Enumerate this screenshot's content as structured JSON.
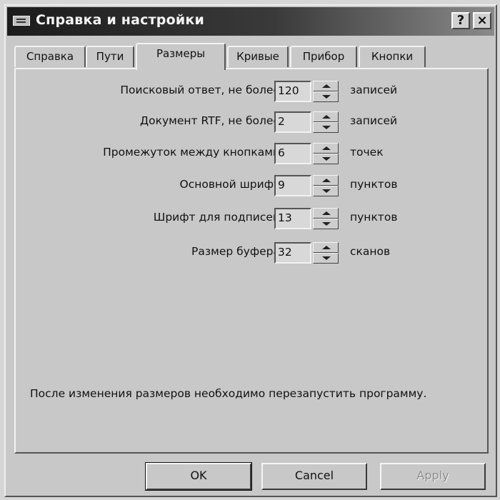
{
  "window": {
    "title": "Справка и настройки",
    "help_label": "?",
    "close_label": "×"
  },
  "tabs": [
    {
      "label": "Справка",
      "active": false
    },
    {
      "label": "Пути",
      "active": false
    },
    {
      "label": "Размеры",
      "active": true
    },
    {
      "label": "Кривые",
      "active": false
    },
    {
      "label": "Прибор",
      "active": false
    },
    {
      "label": "Кнопки",
      "active": false
    }
  ],
  "settings": [
    {
      "label": "Поисковый ответ, не более",
      "value": "120",
      "unit": "записей"
    },
    {
      "label": "Документ RTF, не более",
      "value": "2",
      "unit": "записей"
    },
    {
      "label": "Промежуток между кнопками",
      "value": "6",
      "unit": "точек"
    },
    {
      "label": "Основной шрифт",
      "value": "9",
      "unit": "пунктов"
    },
    {
      "label": "Шрифт для подписей",
      "value": "13",
      "unit": "пунктов"
    },
    {
      "label": "Размер буфера",
      "value": "32",
      "unit": "сканов"
    }
  ],
  "note": "После изменения размеров необходимо перезапустить программу.",
  "buttons": {
    "ok": "OK",
    "cancel": "Cancel",
    "apply": "Apply"
  }
}
